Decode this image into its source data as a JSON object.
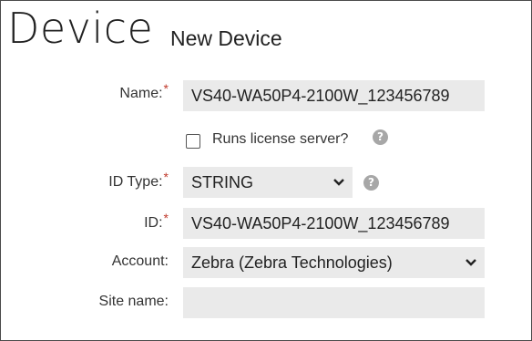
{
  "header": {
    "title": "Device",
    "subtitle": "New Device"
  },
  "form": {
    "name": {
      "label": "Name:",
      "required_mark": "*",
      "value": "VS40-WA50P4-2100W_123456789"
    },
    "runs_license_server": {
      "label": "Runs license server?",
      "checked": false,
      "help_icon": "help-icon"
    },
    "id_type": {
      "label": "ID Type:",
      "required_mark": "*",
      "selected": "STRING",
      "help_icon": "help-icon"
    },
    "id": {
      "label": "ID:",
      "required_mark": "*",
      "value": "VS40-WA50P4-2100W_123456789"
    },
    "account": {
      "label": "Account:",
      "selected": "Zebra (Zebra Technologies)"
    },
    "site_name": {
      "label": "Site name:",
      "value": ""
    }
  },
  "icons": {
    "dropdown": "chevron-down-icon",
    "help": "question-mark-icon"
  },
  "colors": {
    "required": "#c0392b",
    "field_bg": "#eaeaea",
    "help_bg": "#a7a7a7"
  }
}
